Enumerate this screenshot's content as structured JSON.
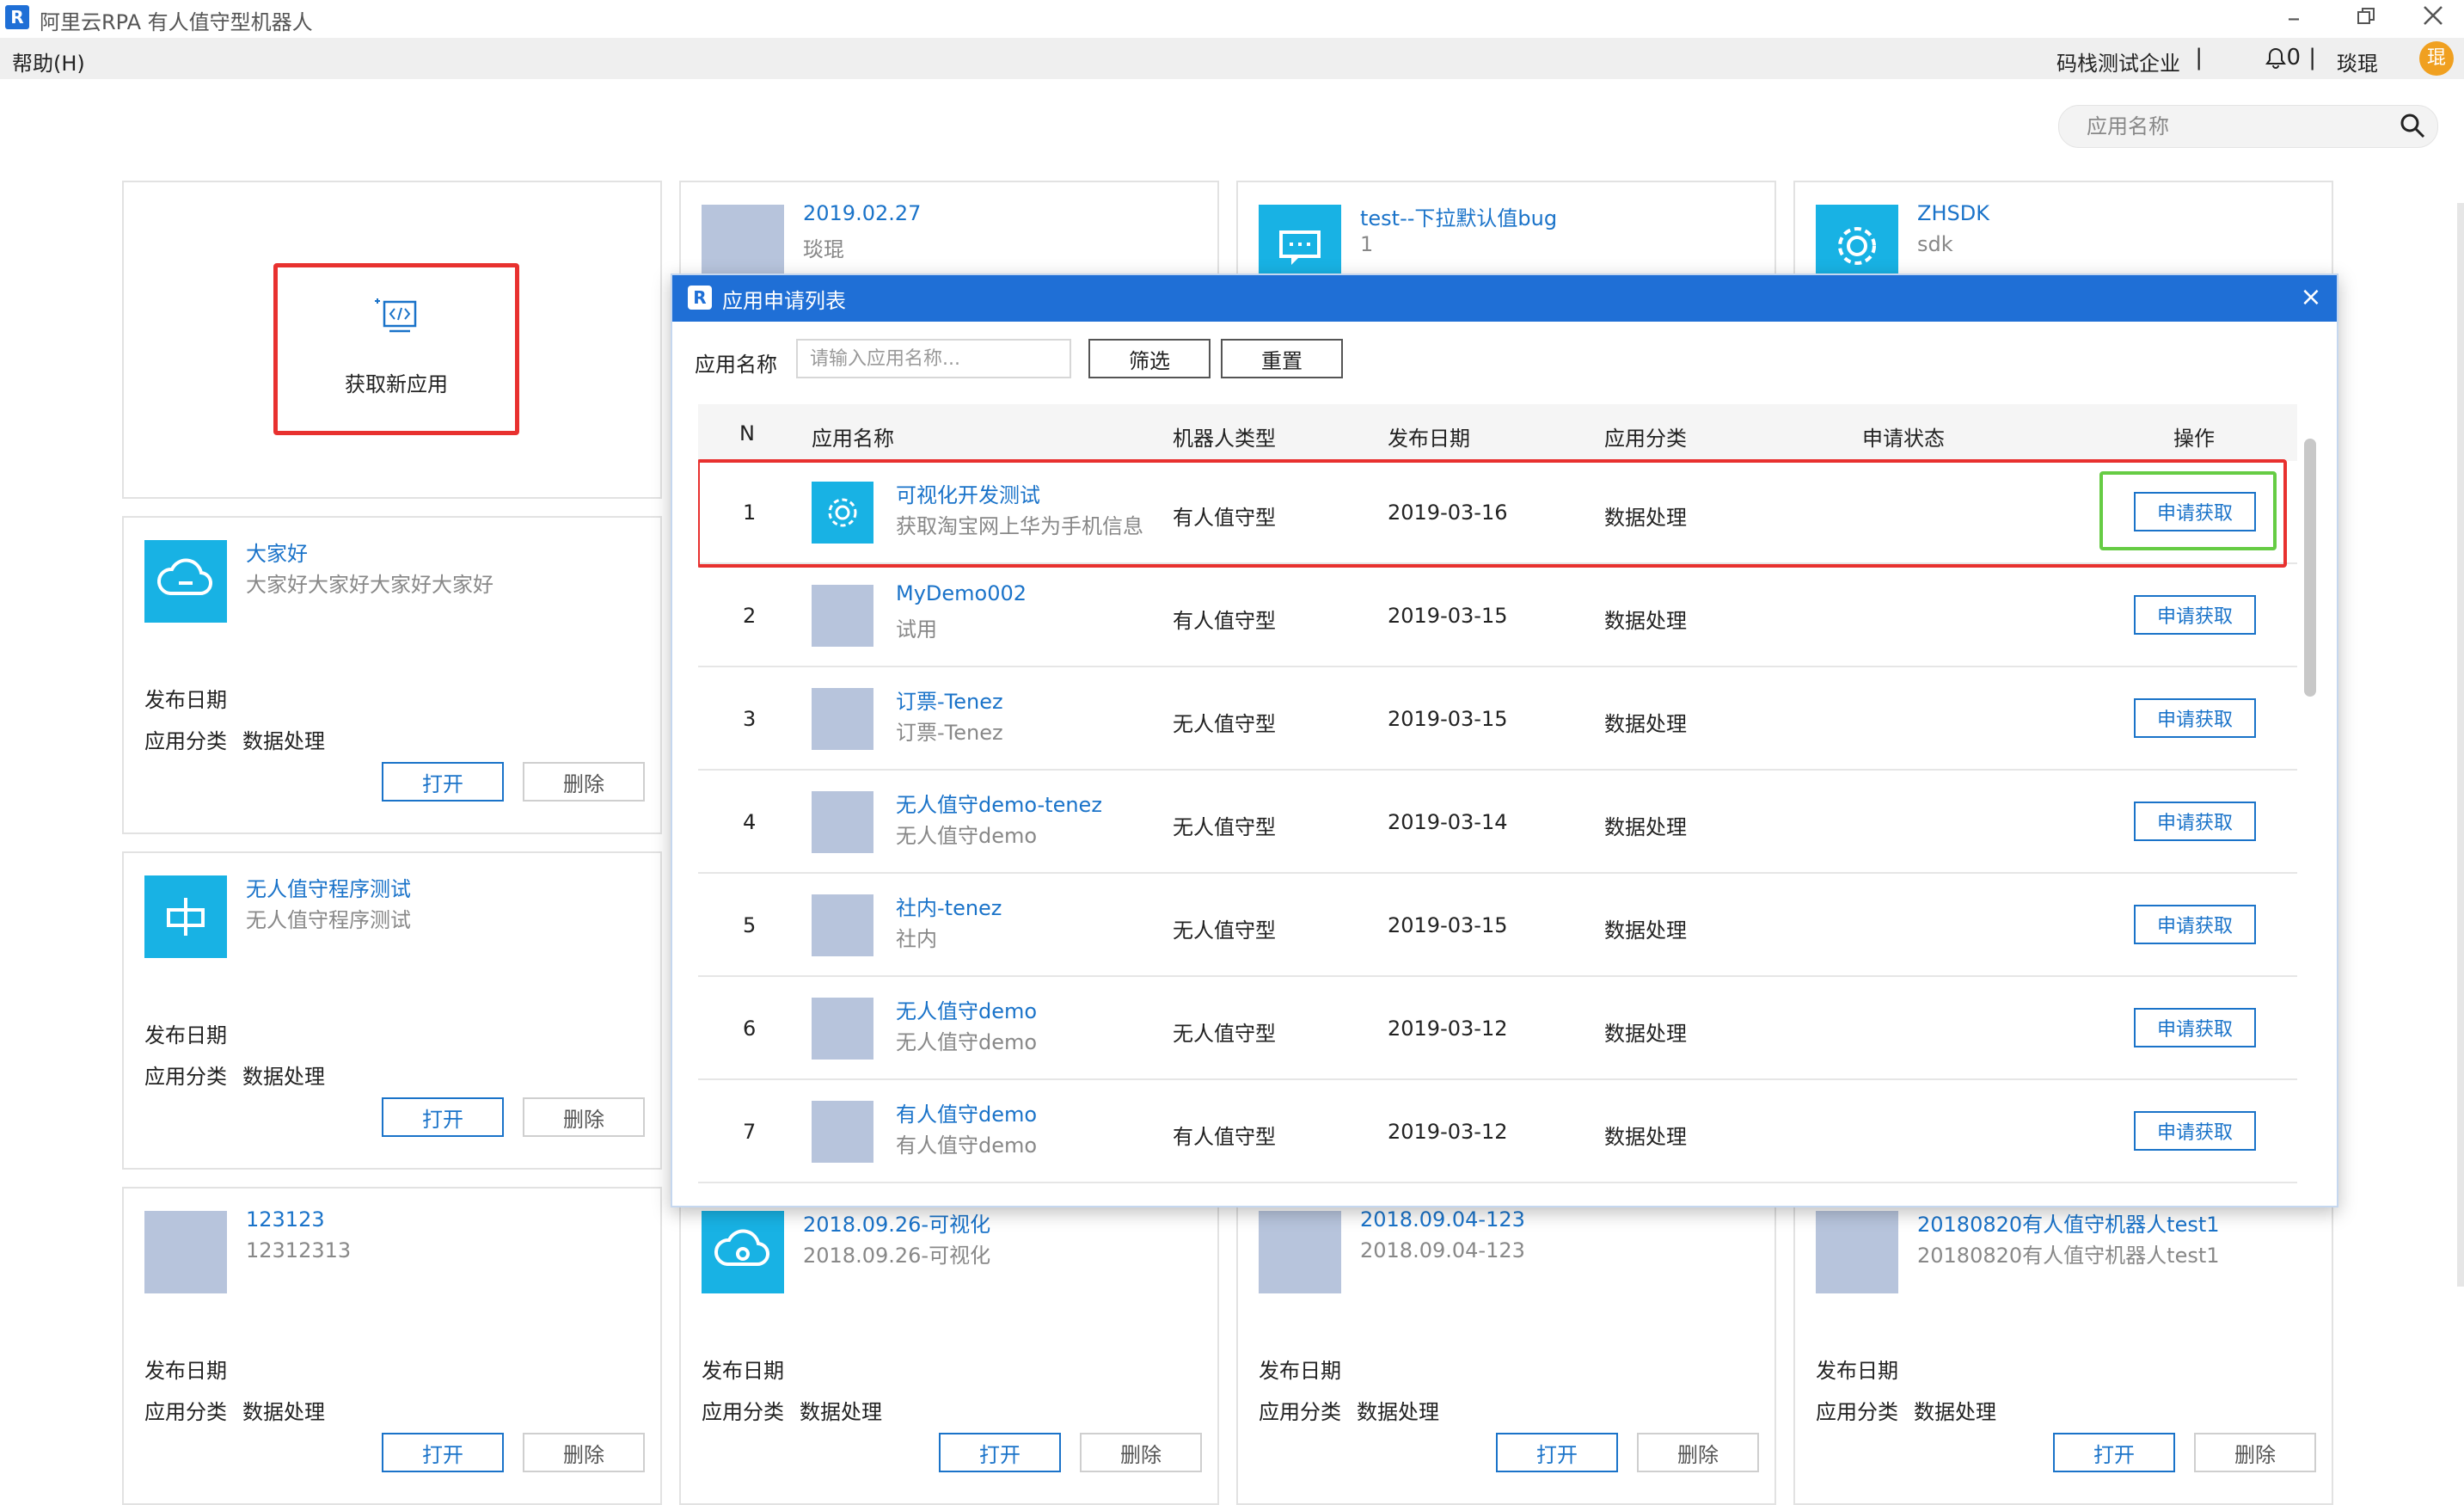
{
  "window": {
    "title": "阿里云RPA 有人值守型机器人",
    "logo": "R",
    "menu_help": "帮助(H)"
  },
  "header": {
    "company": "码栈测试企业",
    "separator": "|",
    "notifications": "0",
    "user": "琰琨",
    "avatar_text": "琨"
  },
  "search": {
    "placeholder": "应用名称"
  },
  "new_app": {
    "label": "获取新应用"
  },
  "labels": {
    "publish_date": "发布日期",
    "category": "应用分类",
    "open": "打开",
    "delete": "删除"
  },
  "cards": [
    {
      "title": "2019.02.27",
      "subtitle": "琰琨",
      "icon": "placeholder"
    },
    {
      "title": "test--下拉默认值bug",
      "subtitle": "1",
      "icon": "message-icon"
    },
    {
      "title": "ZHSDK",
      "subtitle": "sdk",
      "icon": "gear-icon"
    },
    {
      "title": "大家好",
      "subtitle": "大家好大家好大家好大家好",
      "icon": "cloud-chat-icon",
      "category": "数据处理"
    },
    {
      "title": "无人值守程序测试",
      "subtitle": "无人值守程序测试",
      "icon": "split-icon",
      "category": "数据处理"
    },
    {
      "title": "123123",
      "subtitle": "12312313",
      "icon": "placeholder",
      "category": "数据处理"
    },
    {
      "title": "2018.09.26-可视化",
      "subtitle": "2018.09.26-可视化",
      "icon": "cloud-icon",
      "category": "数据处理"
    },
    {
      "title": "2018.09.04-123",
      "subtitle": "2018.09.04-123",
      "icon": "placeholder",
      "category": "数据处理"
    },
    {
      "title": "20180820有人值守机器人test1",
      "subtitle": "20180820有人值守机器人test1",
      "icon": "placeholder",
      "category": "数据处理"
    }
  ],
  "dialog": {
    "title": "应用申请列表",
    "logo": "R",
    "close": "×",
    "filter_label": "应用名称",
    "filter_placeholder": "请输入应用名称...",
    "filter_button": "筛选",
    "reset_button": "重置",
    "columns": [
      "N",
      "应用名称",
      "机器人类型",
      "发布日期",
      "应用分类",
      "申请状态",
      "操作"
    ],
    "apply_label": "申请获取",
    "rows": [
      {
        "n": "1",
        "name": "可视化开发测试",
        "desc": "获取淘宝网上华为手机信息",
        "type": "有人值守型",
        "date": "2019-03-16",
        "category": "数据处理",
        "icon": "gear-icon"
      },
      {
        "n": "2",
        "name": "MyDemo002",
        "desc": "试用",
        "type": "有人值守型",
        "date": "2019-03-15",
        "category": "数据处理",
        "icon": "placeholder"
      },
      {
        "n": "3",
        "name": "订票-Tenez",
        "desc": "订票-Tenez",
        "type": "无人值守型",
        "date": "2019-03-15",
        "category": "数据处理",
        "icon": "placeholder"
      },
      {
        "n": "4",
        "name": "无人值守demo-tenez",
        "desc": "无人值守demo",
        "type": "无人值守型",
        "date": "2019-03-14",
        "category": "数据处理",
        "icon": "placeholder"
      },
      {
        "n": "5",
        "name": "社内-tenez",
        "desc": "社内",
        "type": "无人值守型",
        "date": "2019-03-15",
        "category": "数据处理",
        "icon": "placeholder"
      },
      {
        "n": "6",
        "name": "无人值守demo",
        "desc": "无人值守demo",
        "type": "无人值守型",
        "date": "2019-03-12",
        "category": "数据处理",
        "icon": "placeholder"
      },
      {
        "n": "7",
        "name": "有人值守demo",
        "desc": "有人值守demo",
        "type": "有人值守型",
        "date": "2019-03-12",
        "category": "数据处理",
        "icon": "placeholder"
      }
    ]
  },
  "colors": {
    "accent": "#1f6fd6",
    "link": "#1a73c9",
    "teal": "#18b2e4",
    "highlight_red": "#e8312f",
    "highlight_green": "#66cc44"
  }
}
